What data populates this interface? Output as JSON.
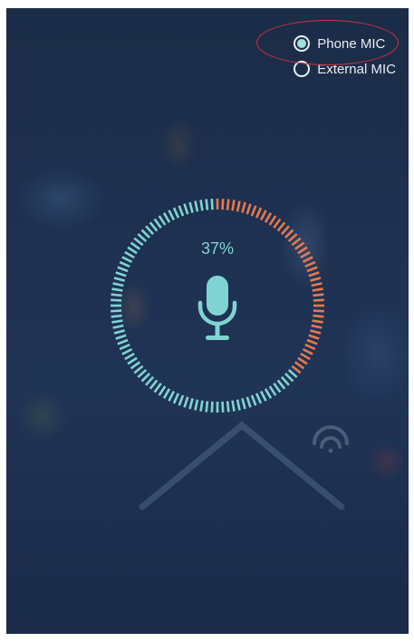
{
  "mic_options": {
    "phone": {
      "label": "Phone MIC",
      "selected": true
    },
    "external": {
      "label": "External MIC",
      "selected": false
    }
  },
  "gauge": {
    "percent_text": "37%",
    "level_fraction": 0.37,
    "total_ticks": 120
  },
  "icons": [
    "radio-selected-icon",
    "radio-unselected-icon",
    "microphone-icon",
    "wifi-icon",
    "house-outline-icon"
  ],
  "colors": {
    "background": "#1f3253",
    "gauge_filled": "#e57a4f",
    "gauge_remaining": "#7fd4d2",
    "mic": "#7fd4d2",
    "highlight": "#d3303a"
  }
}
